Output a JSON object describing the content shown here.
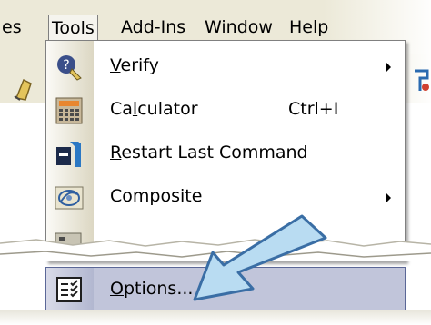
{
  "menubar": {
    "items": [
      {
        "label": "es"
      },
      {
        "label": "Tools"
      },
      {
        "label": "Add-Ins"
      },
      {
        "label": "Window"
      },
      {
        "label": "Help"
      }
    ]
  },
  "menu": {
    "items": [
      {
        "label": "Verify",
        "shortcut": "",
        "submenu": true,
        "icon": "verify-icon"
      },
      {
        "label": "Calculator",
        "shortcut": "Ctrl+I",
        "submenu": false,
        "icon": "calculator-icon"
      },
      {
        "label": "Restart Last Command",
        "shortcut": "",
        "submenu": false,
        "icon": "restart-icon"
      },
      {
        "label": "Composite",
        "shortcut": "",
        "submenu": true,
        "icon": "composite-icon"
      }
    ],
    "options": {
      "label": "Options...",
      "icon": "options-icon",
      "highlighted": true
    }
  },
  "colors": {
    "menubar_bg": "#ece9d8",
    "highlight_bg": "#c1c5da",
    "highlight_border": "#5b6797",
    "arrow_fill": "#b9dcf2",
    "arrow_stroke": "#3a6ea5"
  }
}
